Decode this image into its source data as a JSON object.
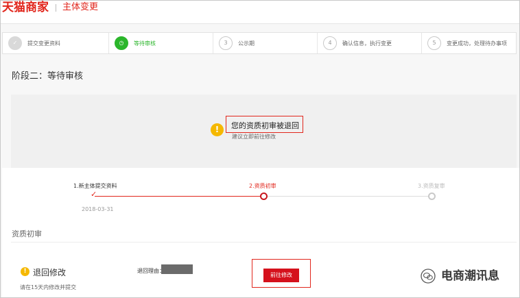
{
  "header": {
    "logo": "天猫商家",
    "subtitle": "主体变更"
  },
  "steps": [
    {
      "num": "✓",
      "label": "提交变更资料",
      "state": "done"
    },
    {
      "num": "◷",
      "label": "等待审核",
      "state": "active"
    },
    {
      "num": "3",
      "label": "公示期",
      "state": "todo"
    },
    {
      "num": "4",
      "label": "确认信息，执行变更",
      "state": "todo"
    },
    {
      "num": "5",
      "label": "变更成功，处理待办事项",
      "state": "todo"
    }
  ],
  "stage_title": "阶段二：等待审核",
  "alert": {
    "icon": "warning-icon",
    "title": "您的资质初审被退回",
    "subtitle": "建议立即前往修改"
  },
  "progress": {
    "nodes": [
      {
        "label": "1.新主体提交资料",
        "color": "#333333"
      },
      {
        "label": "2.资质初审",
        "color": "#e1251b"
      },
      {
        "label": "3.资质复审",
        "color": "#bbbbbb"
      }
    ],
    "date": "2018-03-31"
  },
  "section": {
    "title": "资质初审"
  },
  "returned": {
    "title": "退回修改",
    "note": "请在15天内修改并提交",
    "reason_label": "退回理由：",
    "button_label": "前往修改"
  },
  "watermark": {
    "text": "电商潮讯息",
    "icon": "wechat-icon"
  },
  "colors": {
    "brand": "#e1251b",
    "active_step": "#2bb62b",
    "warning": "#f5b800"
  }
}
